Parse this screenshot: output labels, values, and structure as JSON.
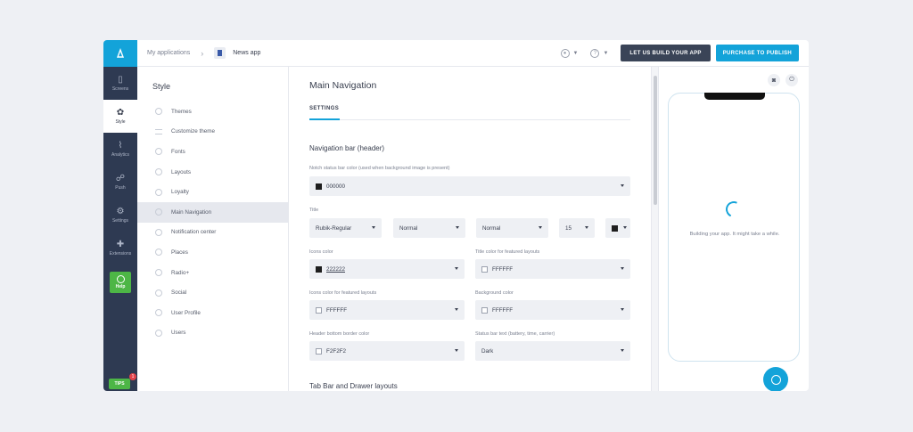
{
  "topbar": {
    "breadcrumb_root": "My applications",
    "breadcrumb_app": "News app",
    "build_button": "LET US BUILD YOUR APP",
    "publish_button": "PURCHASE TO PUBLISH"
  },
  "leftnav": {
    "items": [
      {
        "label": "Screens",
        "icon": "screens-icon"
      },
      {
        "label": "Style",
        "icon": "style-icon"
      },
      {
        "label": "Analytics",
        "icon": "analytics-icon"
      },
      {
        "label": "Push",
        "icon": "push-icon"
      },
      {
        "label": "Settings",
        "icon": "settings-icon"
      },
      {
        "label": "Extensions",
        "icon": "extensions-icon"
      }
    ],
    "help_label": "Help",
    "tips_label": "TIPS",
    "tips_badge": "1"
  },
  "stylepanel": {
    "title": "Style",
    "items": [
      {
        "label": "Themes"
      },
      {
        "label": "Customize theme"
      },
      {
        "label": "Fonts"
      },
      {
        "label": "Layouts"
      },
      {
        "label": "Loyalty"
      },
      {
        "label": "Main Navigation"
      },
      {
        "label": "Notification center"
      },
      {
        "label": "Places"
      },
      {
        "label": "Radio+"
      },
      {
        "label": "Social"
      },
      {
        "label": "User Profile"
      },
      {
        "label": "Users"
      }
    ]
  },
  "content": {
    "title": "Main Navigation",
    "tab": "SETTINGS",
    "section_header": "Navigation bar (header)",
    "notch_label": "Notch status bar color (used when background image is present)",
    "notch_value": "000000",
    "title_label": "Title",
    "title_font": "Rubik-Regular",
    "title_weight": "Normal",
    "title_style": "Normal",
    "title_size": "15",
    "icons_color_label": "Icons color",
    "icons_color_value": "222222",
    "title_featured_label": "Title color for featured layouts",
    "title_featured_value": "FFFFFF",
    "icons_featured_label": "Icons color for featured layouts",
    "icons_featured_value": "FFFFFF",
    "background_label": "Background color",
    "background_value": "FFFFFF",
    "header_border_label": "Header bottom border color",
    "header_border_value": "F2F2F2",
    "status_bar_label": "Status bar text (battery, time, carrier)",
    "status_bar_value": "Dark",
    "section_tabbar": "Tab Bar and Drawer layouts"
  },
  "preview": {
    "message": "Building your app. It might take a while."
  },
  "colors": {
    "accent": "#13a3d9",
    "nav_bg": "#2e3a52",
    "help_green": "#4db646"
  }
}
